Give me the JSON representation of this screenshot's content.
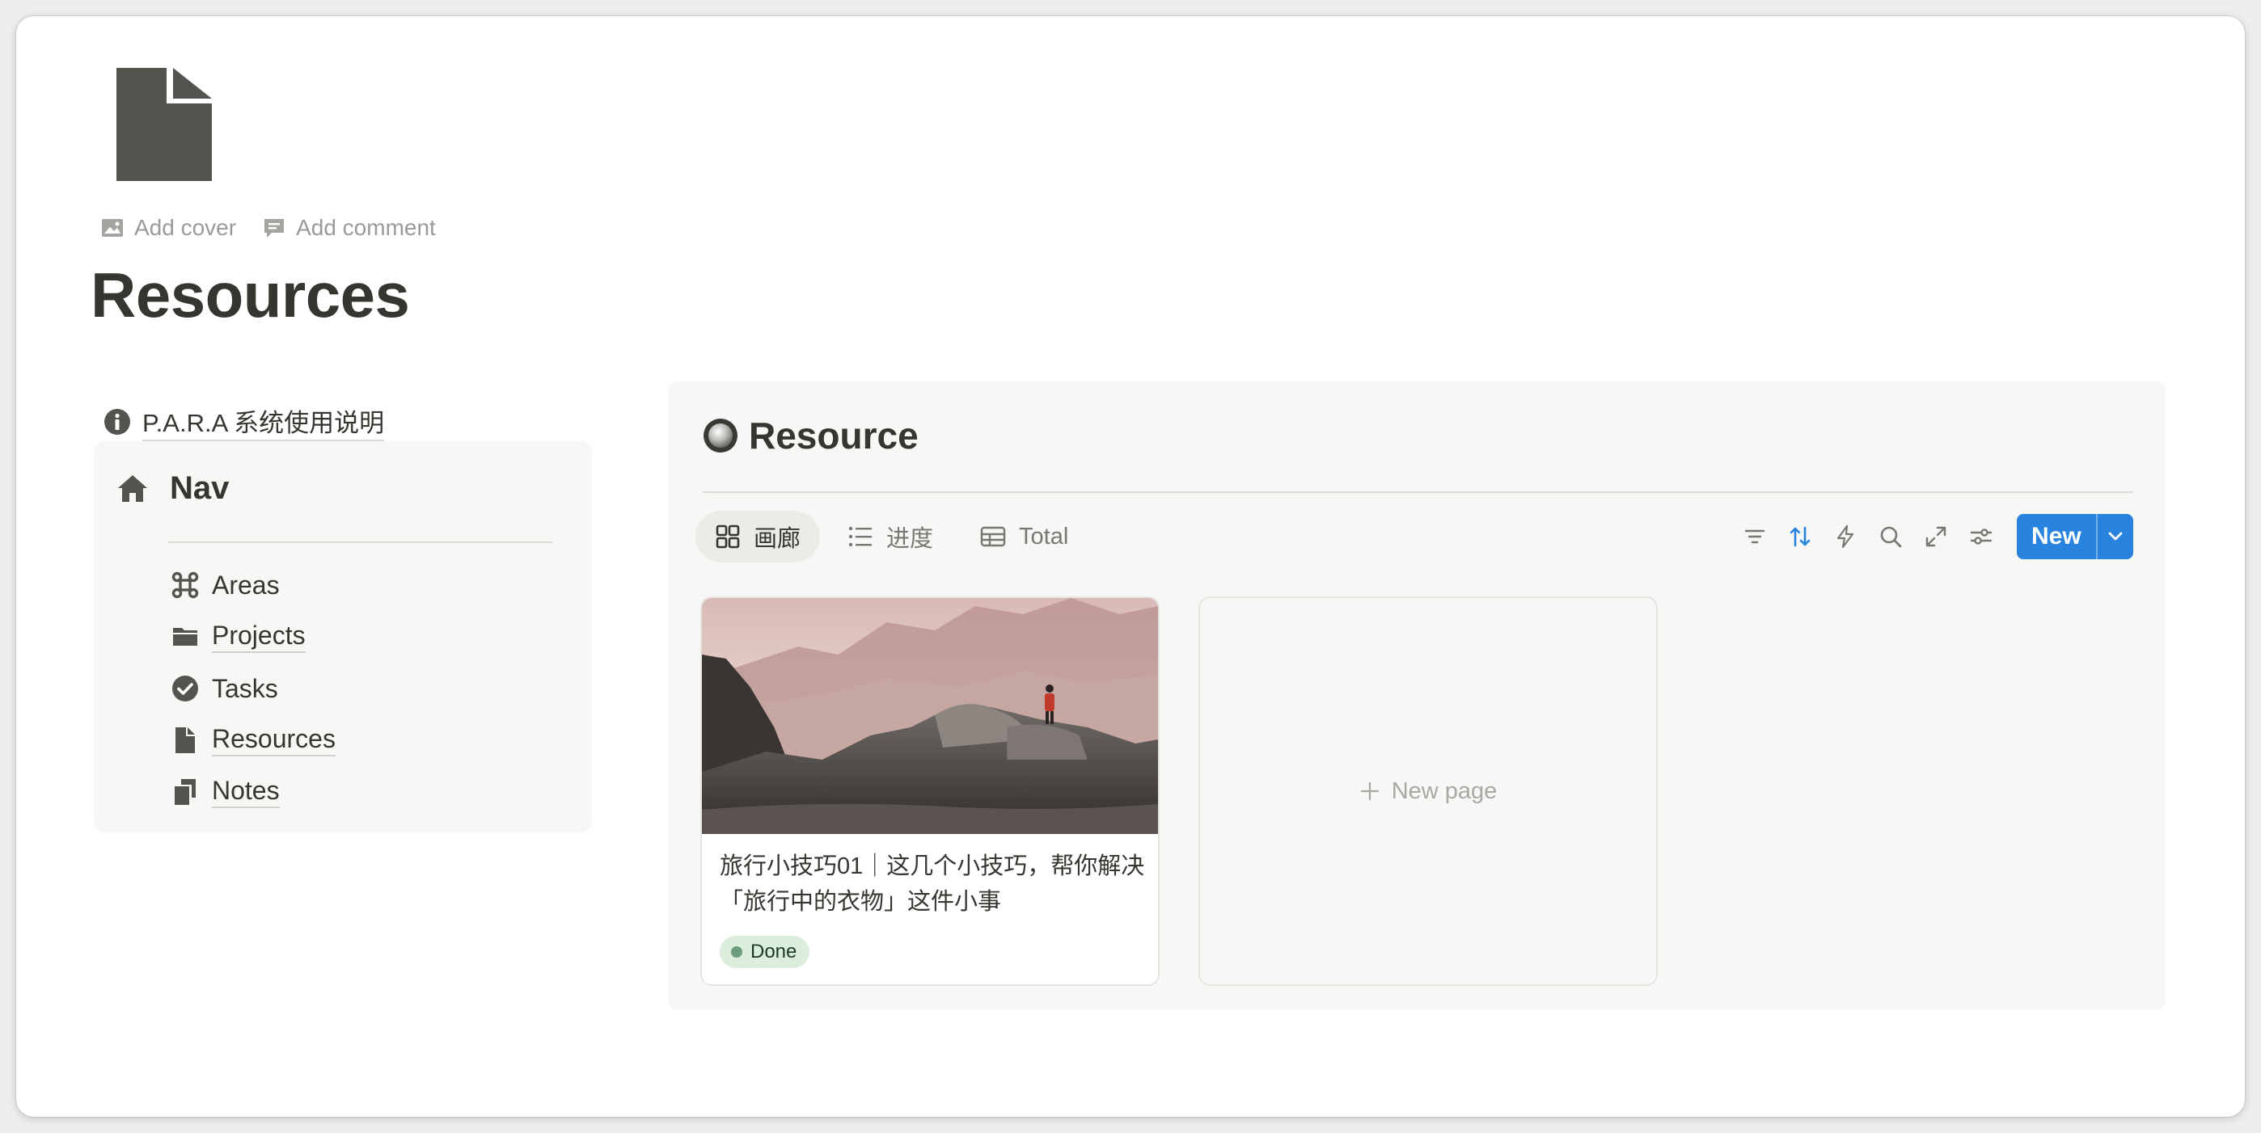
{
  "page": {
    "icon": "page-icon",
    "add_cover": "Add cover",
    "add_comment": "Add comment",
    "title": "Resources"
  },
  "sidebar": {
    "info_link": "P.A.R.A 系统使用说明",
    "nav": {
      "title": "Nav",
      "items": [
        {
          "label": "Areas",
          "icon": "command-icon"
        },
        {
          "label": "Projects",
          "icon": "folder-icon"
        },
        {
          "label": "Tasks",
          "icon": "check-circle-icon"
        },
        {
          "label": "Resources",
          "icon": "page-icon"
        },
        {
          "label": "Notes",
          "icon": "copy-icon"
        }
      ]
    }
  },
  "database": {
    "title": "Resource",
    "tabs": [
      {
        "label": "画廊",
        "active": true
      },
      {
        "label": "进度",
        "active": false
      },
      {
        "label": "Total",
        "active": false
      }
    ],
    "new_label": "New",
    "accent_color": "#2783de",
    "cards": [
      {
        "title": "旅行小技巧01｜这几个小技巧，帮你解决「旅行中的衣物」这件小事",
        "status": "Done",
        "status_color": "#dbeddb"
      }
    ],
    "new_page_label": "New page"
  }
}
